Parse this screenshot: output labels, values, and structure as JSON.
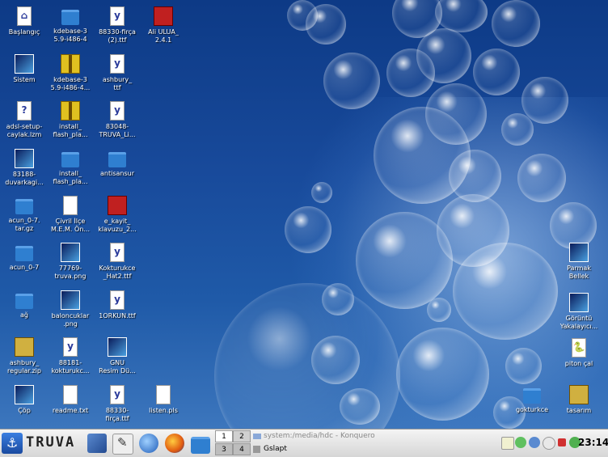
{
  "desktop": {
    "icons": [
      {
        "label": "Başlangıç",
        "icon": "home-icon"
      },
      {
        "label": "kdebase-3\n5.9-i486-4",
        "icon": "folder-icon"
      },
      {
        "label": "88330-firça\n(2).ttf",
        "icon": "font-file-icon"
      },
      {
        "label": "Ali ULUA_\n2.4.1",
        "icon": "red-disc-icon"
      },
      {
        "label": "Sistem",
        "icon": "monitor-icon"
      },
      {
        "label": "kdebase-3\n5.9-i486-4...",
        "icon": "package-icon"
      },
      {
        "label": "ashbury_\nttf",
        "icon": "font-file-icon"
      },
      {
        "label": "adsl-setup-\ncaylak.lzm",
        "icon": "unknown-file-icon"
      },
      {
        "label": "install_\nflash_pla...",
        "icon": "package-icon"
      },
      {
        "label": "83048-\nTRUVA_Li...",
        "icon": "font-file-icon"
      },
      {
        "label": "83188-\nduvarkagi...",
        "icon": "image-file-icon"
      },
      {
        "label": "install_\nflash_pla...",
        "icon": "folder-icon"
      },
      {
        "label": "antisansur",
        "icon": "folder-icon"
      },
      {
        "label": "acun_0-7.\ntar.gz",
        "icon": "archive-icon"
      },
      {
        "label": "Çivril İlçe\nM.E.M. Ön...",
        "icon": "document-icon"
      },
      {
        "label": "e_kayit_\nklavuzu_2...",
        "icon": "pdf-icon"
      },
      {
        "label": "acun_0-7",
        "icon": "folder-icon"
      },
      {
        "label": "77769-\ntruva.png",
        "icon": "image-file-icon"
      },
      {
        "label": "Kokturukce\n_Hat2.ttf",
        "icon": "font-file-icon"
      },
      {
        "label": "ağ",
        "icon": "folder-icon"
      },
      {
        "label": "baloncuklar\n.png",
        "icon": "image-file-icon"
      },
      {
        "label": "1ORKUN.ttf",
        "icon": "font-file-icon"
      },
      {
        "label": "ashbury_\nregular.zip",
        "icon": "zip-icon"
      },
      {
        "label": "88181-\nkokturukc...",
        "icon": "font-file-icon"
      },
      {
        "label": "GNU\nResim Dü...",
        "icon": "gimp-icon"
      },
      {
        "label": "Çöp",
        "icon": "trash-icon"
      },
      {
        "label": "readme.txt",
        "icon": "text-file-icon"
      },
      {
        "label": "88330-\nfirça.ttf",
        "icon": "font-file-icon"
      },
      {
        "label": "listen.pls",
        "icon": "playlist-icon"
      }
    ],
    "right_icons": [
      {
        "label": "Parmak\nBellek",
        "icon": "usb-drive-icon"
      },
      {
        "label": "Görüntü\nYakalayıcı...",
        "icon": "screenshot-icon"
      },
      {
        "label": "piton çal",
        "icon": "python-icon"
      },
      {
        "label": "gokturkce",
        "icon": "folder-icon"
      },
      {
        "label": "tasarım",
        "icon": "palette-icon"
      }
    ]
  },
  "taskbar": {
    "logo_text": "TRUVA",
    "pager": [
      "1",
      "2",
      "3",
      "4"
    ],
    "tasks": [
      {
        "label": "system:/media/hdc - Konquero"
      },
      {
        "label": "Gslapt"
      }
    ],
    "clock": "23:14",
    "accent": "#2a62c4"
  }
}
